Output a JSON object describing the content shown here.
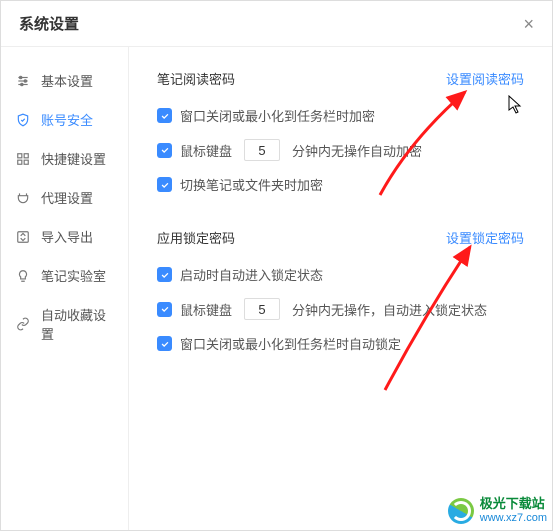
{
  "window": {
    "title": "系统设置"
  },
  "sidebar": {
    "items": [
      {
        "label": "基本设置"
      },
      {
        "label": "账号安全"
      },
      {
        "label": "快捷键设置"
      },
      {
        "label": "代理设置"
      },
      {
        "label": "导入导出"
      },
      {
        "label": "笔记实验室"
      },
      {
        "label": "自动收藏设置"
      }
    ],
    "activeIndex": 1
  },
  "sections": {
    "readPwd": {
      "title": "笔记阅读密码",
      "link": "设置阅读密码",
      "opt1": "窗口关闭或最小化到任务栏时加密",
      "opt2_pre": "鼠标键盘",
      "opt2_val": "5",
      "opt2_post": "分钟内无操作自动加密",
      "opt3": "切换笔记或文件夹时加密"
    },
    "lockPwd": {
      "title": "应用锁定密码",
      "link": "设置锁定密码",
      "opt1": "启动时自动进入锁定状态",
      "opt2_pre": "鼠标键盘",
      "opt2_val": "5",
      "opt2_post": "分钟内无操作，自动进入锁定状态",
      "opt3": "窗口关闭或最小化到任务栏时自动锁定"
    }
  },
  "watermark": {
    "name": "极光下载站",
    "url": "www.xz7.com"
  },
  "colors": {
    "accent": "#3a8bff",
    "arrow": "#ff1a1a"
  }
}
